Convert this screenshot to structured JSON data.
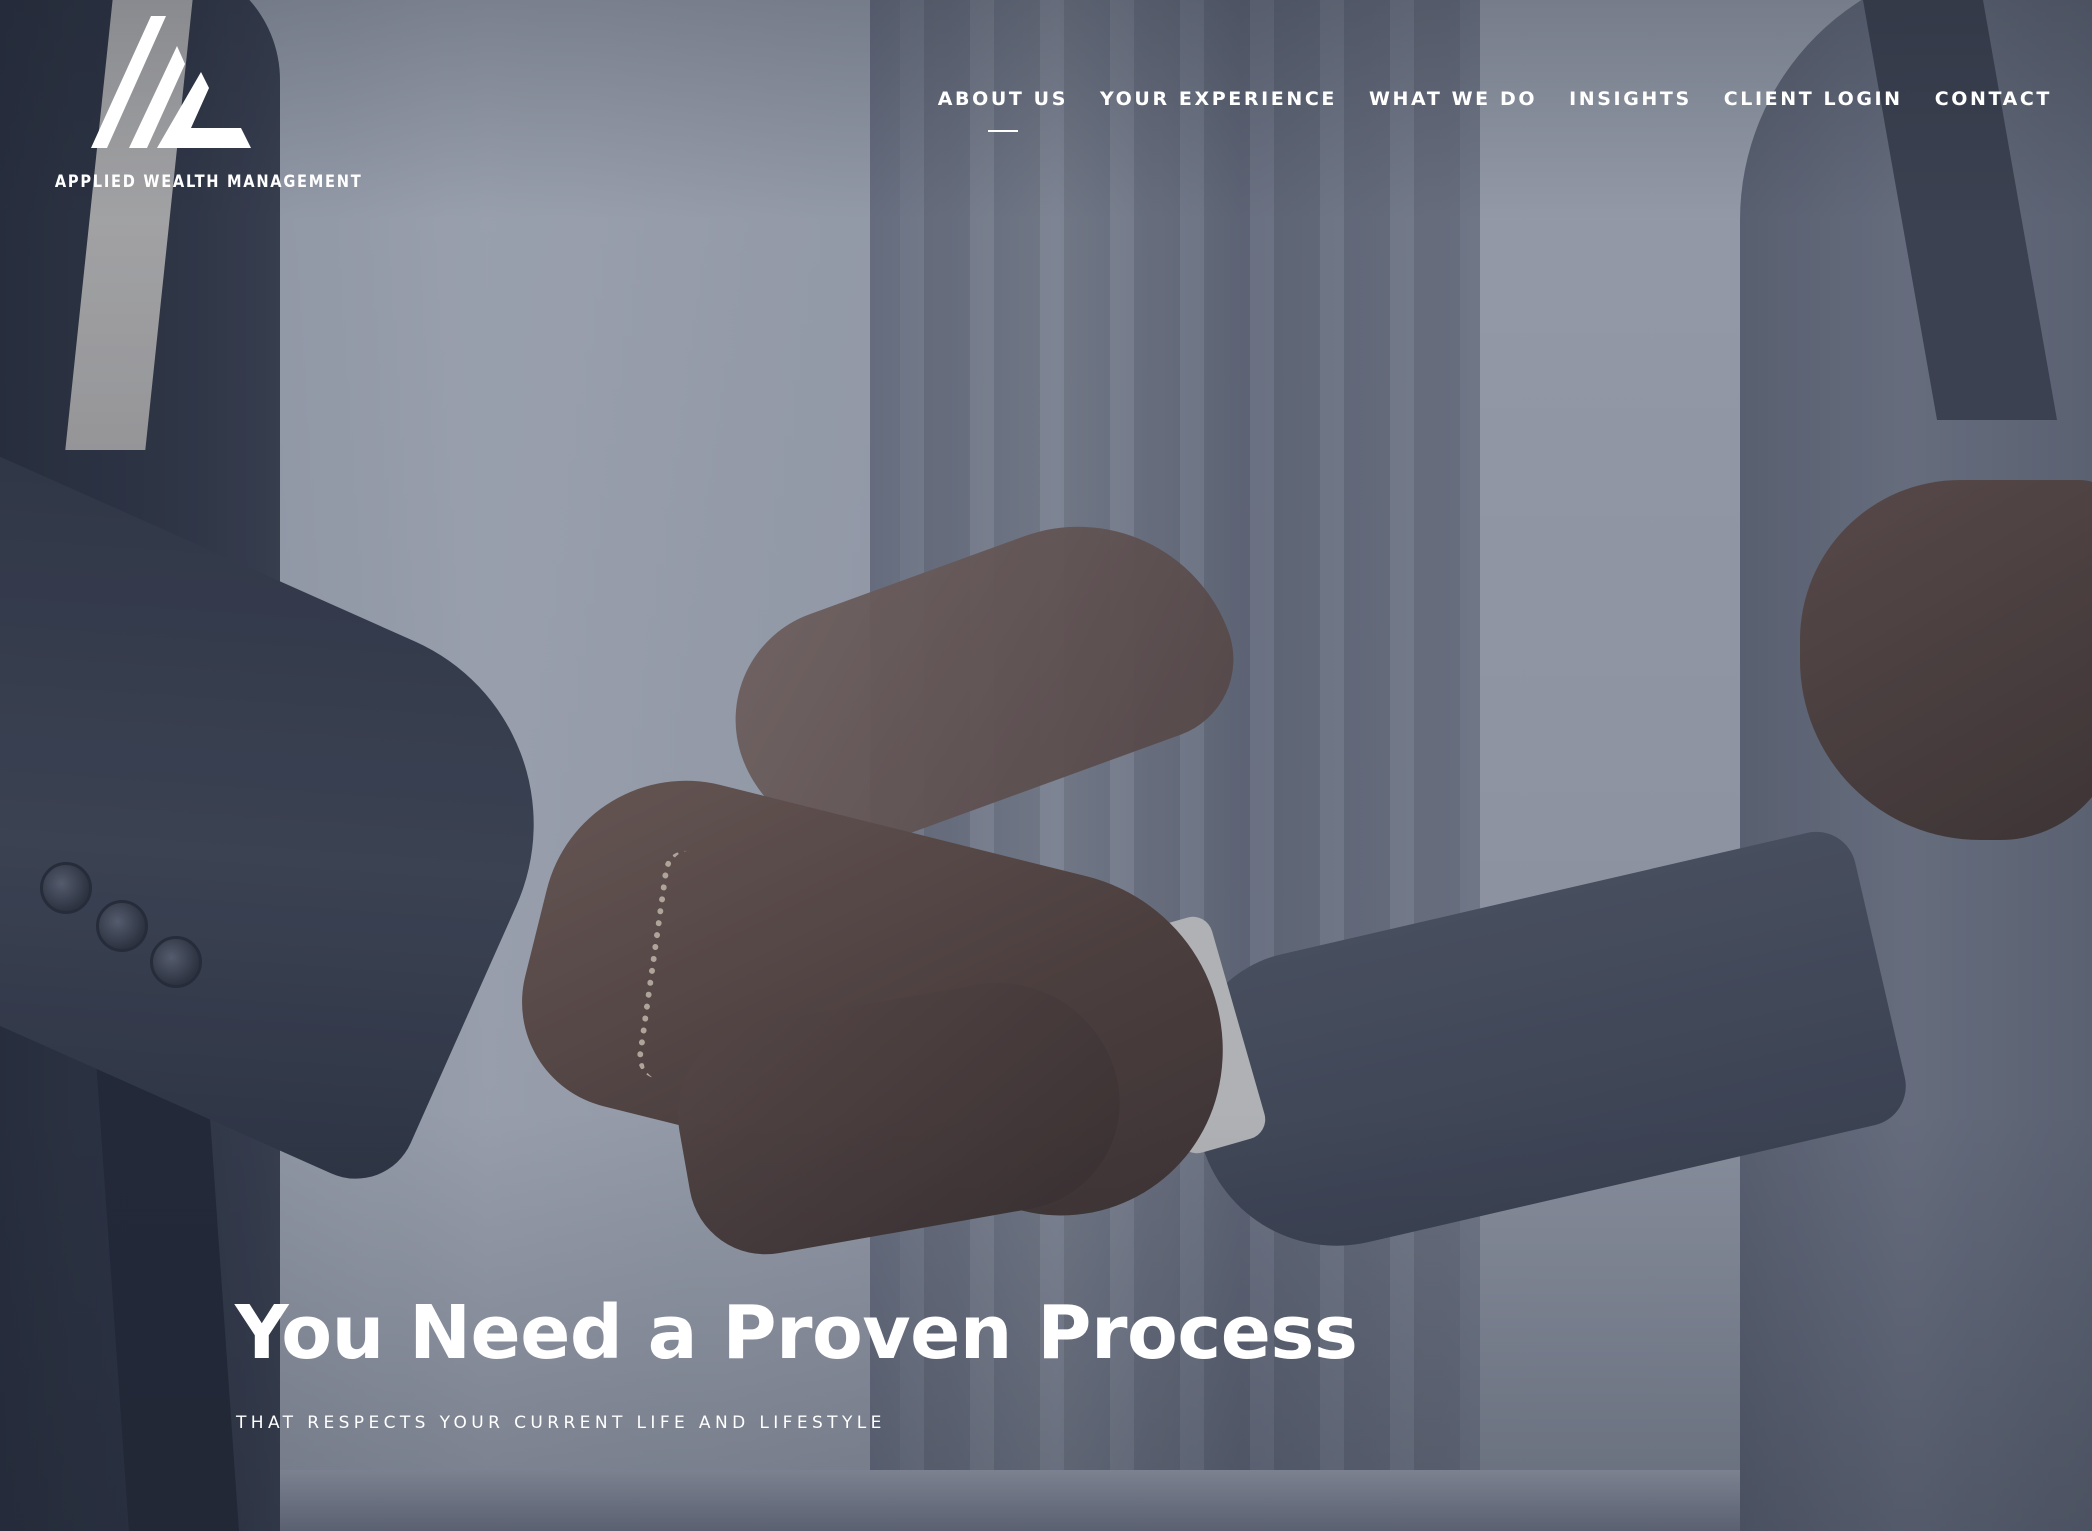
{
  "brand": {
    "name": "APPLIED WEALTH MANAGEMENT",
    "logo_icon": "triangle-logo-icon"
  },
  "nav": {
    "items": [
      {
        "label": "ABOUT US",
        "active": true
      },
      {
        "label": "YOUR EXPERIENCE",
        "active": false
      },
      {
        "label": "WHAT WE DO",
        "active": false
      },
      {
        "label": "INSIGHTS",
        "active": false
      },
      {
        "label": "CLIENT LOGIN",
        "active": false
      },
      {
        "label": "CONTACT",
        "active": false
      }
    ]
  },
  "hero": {
    "headline": "You Need a Proven Process",
    "subheadline": "THAT RESPECTS YOUR CURRENT LIFE AND LIFESTYLE",
    "background": "handshake-photo"
  },
  "colors": {
    "text": "#ffffff",
    "overlay": "#3c465f"
  }
}
